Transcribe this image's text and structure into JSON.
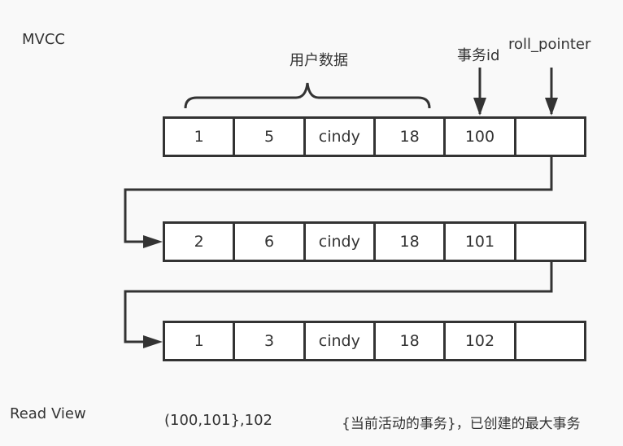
{
  "title": "MVCC",
  "labels": {
    "user_data": "用户数据",
    "trx_id": "事务id",
    "roll_pointer": "roll_pointer"
  },
  "records": [
    {
      "cells": [
        "1",
        "5",
        "cindy",
        "18",
        "100",
        ""
      ]
    },
    {
      "cells": [
        "2",
        "6",
        "cindy",
        "18",
        "101",
        ""
      ]
    },
    {
      "cells": [
        "1",
        "3",
        "cindy",
        "18",
        "102",
        ""
      ]
    }
  ],
  "read_view": {
    "label": "Read View",
    "value": "(100,101},102",
    "description": "{当前活动的事务}，已创建的最大事务"
  },
  "colors": {
    "line": "#333333",
    "background": "#f9f9f9",
    "cell_fill": "#ffffff"
  }
}
